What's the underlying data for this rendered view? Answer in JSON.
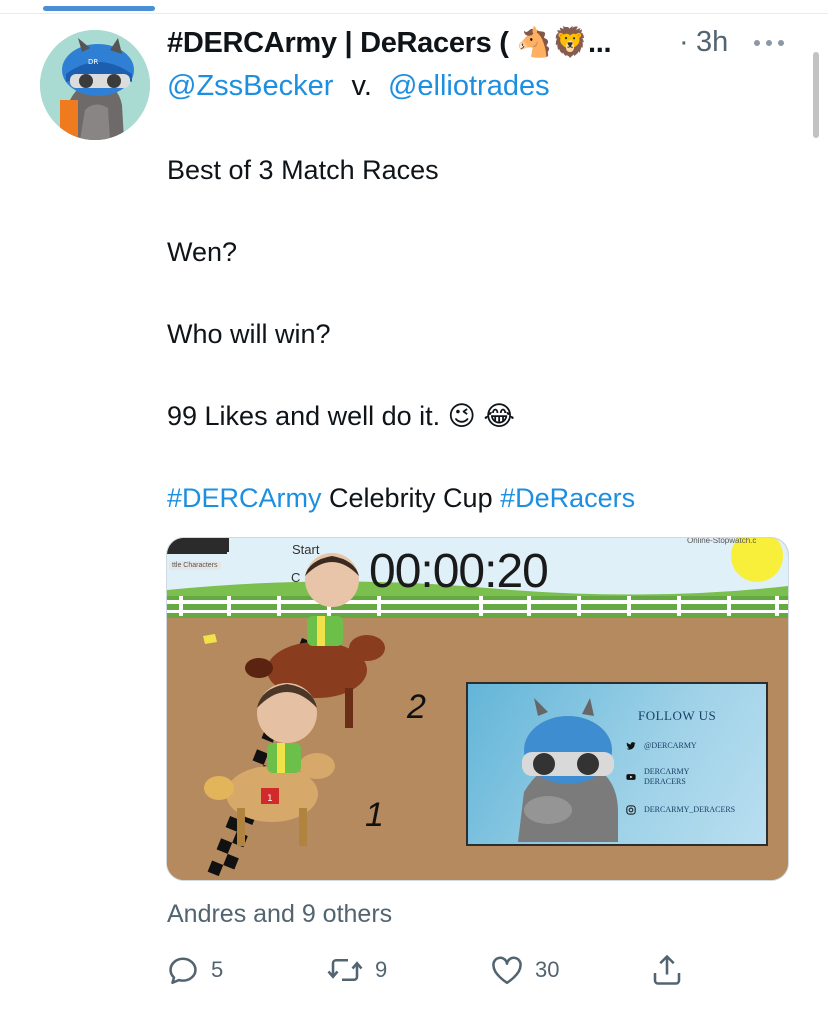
{
  "tweet": {
    "display_name": "#DERCArmy | DeRacers ( 🐴🦁...",
    "time_separator": "·",
    "time": "3h",
    "handle_1": "@ZssBecker",
    "handle_joiner": "v.",
    "handle_2": "@elliotrades",
    "line_1": "Best of 3 Match Races",
    "line_2": "Wen?",
    "line_3": "Who will win?",
    "line_4": "99 Likes and well do it. 😉 😂",
    "hashtag_1": "#DERCArmy",
    "line_5_middle": " Celebrity Cup ",
    "hashtag_2": "#DeRacers"
  },
  "media": {
    "timer": "00:00:20",
    "start_label": "Start",
    "c_label": "C",
    "stopwatch_site": "Online-Stopwatch.c",
    "characters_label": "ttle Characters",
    "lane_2": "2",
    "lane_1": "1",
    "follow_title": "FOLLOW US",
    "follow_twitter": "@DERCARMY",
    "follow_youtube_1": "DERCARMY",
    "follow_youtube_2": "DERACERS",
    "follow_instagram": "DERCARMY_DERACERS"
  },
  "liked_by": "Andres and 9 others",
  "actions": {
    "reply_count": "5",
    "retweet_count": "9",
    "like_count": "30"
  },
  "colors": {
    "link": "#1d8fe1",
    "secondary": "#536471",
    "dirt": "#b88a5e",
    "grass": "#6ab04c"
  }
}
